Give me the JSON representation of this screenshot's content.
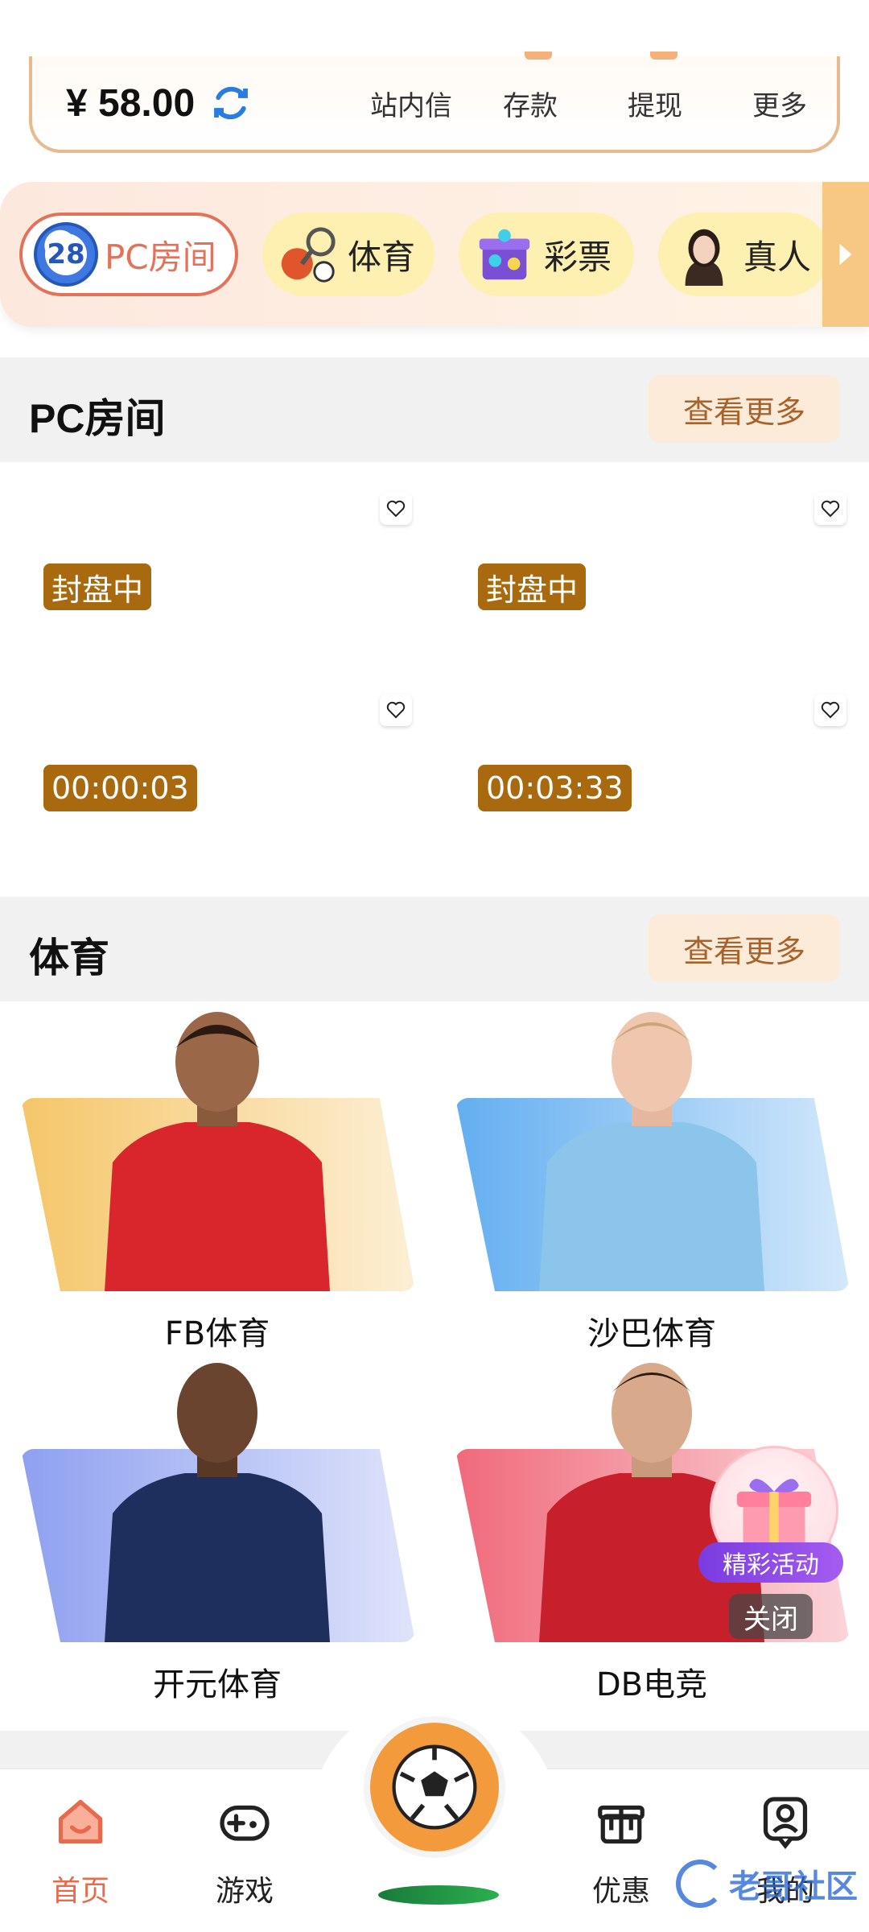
{
  "wallet": {
    "balance": "¥ 58.00",
    "links": [
      "站内信",
      "存款",
      "提现",
      "更多"
    ]
  },
  "categories": [
    {
      "badge": "28",
      "label": "PC房间",
      "icon": "pc-room-28-icon"
    },
    {
      "label": "体育",
      "icon": "sports-balls-icon"
    },
    {
      "label": "彩票",
      "icon": "lottery-box-icon"
    },
    {
      "label": "真人",
      "icon": "live-dealer-avatar-icon"
    }
  ],
  "pc_section": {
    "title": "PC房间",
    "more": "查看更多",
    "rooms": [
      {
        "status": "封盘中"
      },
      {
        "status": "封盘中"
      },
      {
        "status": "00:00:03"
      },
      {
        "status": "00:03:33"
      }
    ]
  },
  "sports_section": {
    "title": "体育",
    "more": "查看更多",
    "items": [
      {
        "name": "FB体育",
        "bg": "#f5c66a",
        "shirt": "#d9262c"
      },
      {
        "name": "沙巴体育",
        "bg": "#63aef0",
        "shirt": "#8cc5ec"
      },
      {
        "name": "开元体育",
        "bg": "#8ea0f0",
        "shirt": "#1e2f5e"
      },
      {
        "name": "DB电竞",
        "bg": "#f06a7a",
        "shirt": "#c8202a"
      }
    ]
  },
  "promo": {
    "tag": "精彩活动",
    "close": "关闭"
  },
  "nav": {
    "home": "首页",
    "games": "游戏",
    "offers": "优惠",
    "mine": "我的"
  },
  "watermark": "老哥社区",
  "colors": {
    "accent": "#e86a4a",
    "status_bg": "#a8690f",
    "more_text": "#a8632c",
    "center_button": "#f29a3c"
  }
}
